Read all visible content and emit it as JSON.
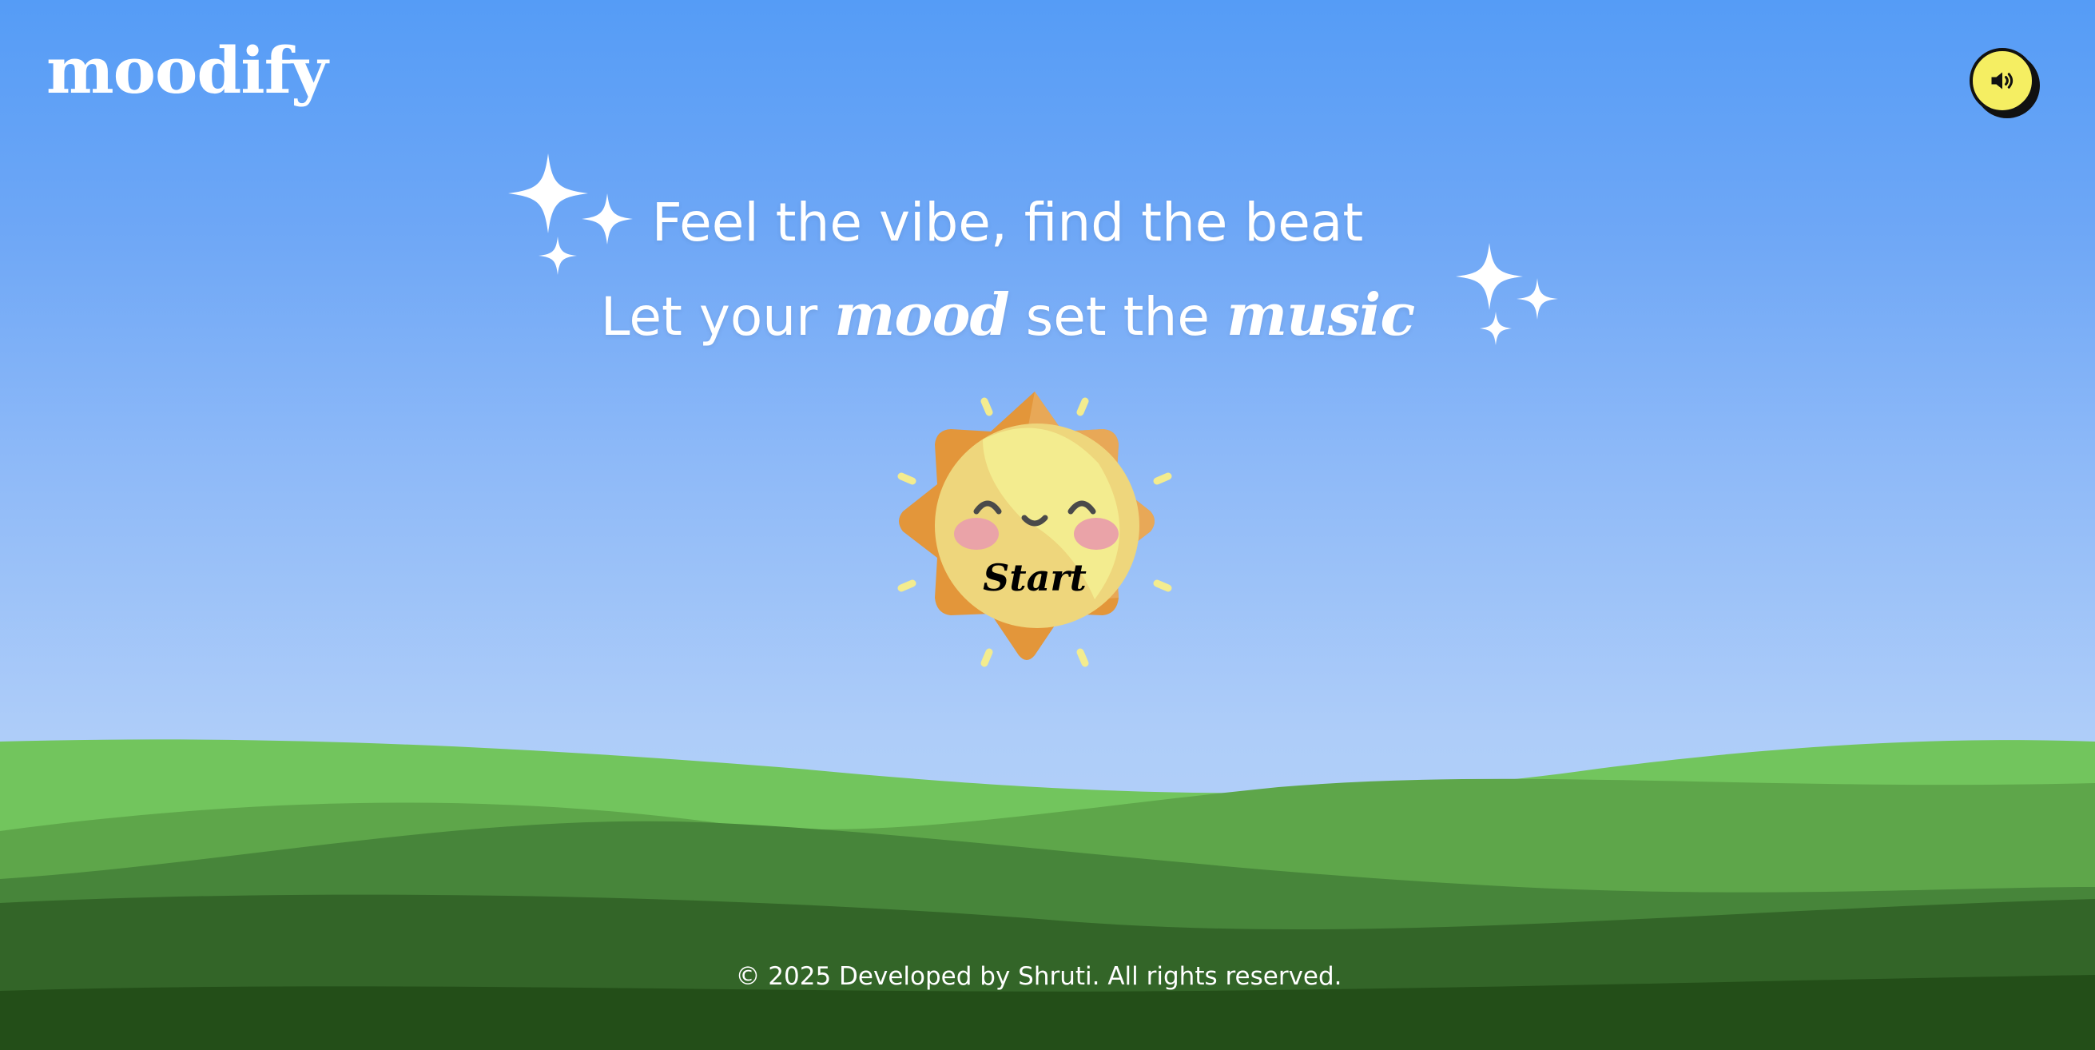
{
  "app": {
    "logo_text": "moodify"
  },
  "header": {
    "sound_button_icon": "speaker-volume-icon"
  },
  "hero": {
    "line1": "Feel the vibe, find the beat",
    "line2_part1": "Let your ",
    "line2_script1": "mood",
    "line2_part2": " set the ",
    "line2_script2": "music"
  },
  "sun_button": {
    "label": "Start",
    "icon": "smiling-sun-icon"
  },
  "footer": {
    "text": "© 2025 Developed by Shruti. All rights reserved."
  },
  "colors": {
    "sky_top": "#559cf6",
    "sky_bottom": "#b9d5fa",
    "hill_light": "#72c55d",
    "hill_mid": "#5ea64a",
    "hill_dark": "#47853a",
    "hill_darker": "#336528",
    "hill_darkest": "#234e18",
    "sound_button_bg": "#f5ee62",
    "sun_outer": "#e3963a",
    "sun_face": "#f3ec8f"
  }
}
